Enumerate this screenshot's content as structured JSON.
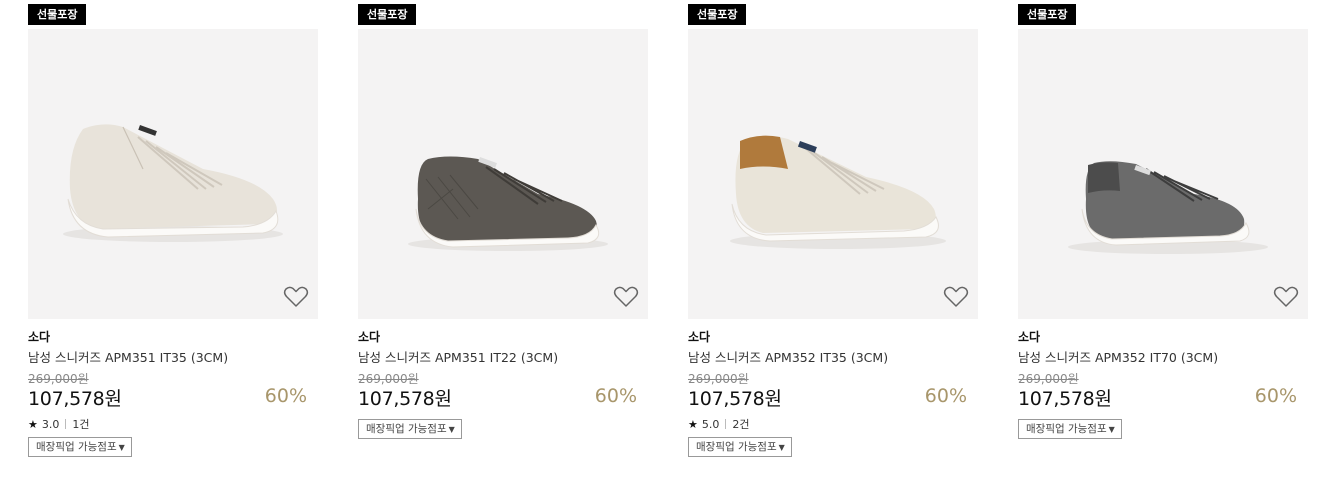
{
  "products": [
    {
      "badge": "선물포장",
      "brand": "소다",
      "name": "남성 스니커즈 APM351 IT35 (3CM)",
      "original_price": "269,000원",
      "price": "107,578원",
      "discount": "60%",
      "rating": "3.0",
      "review_count": "1건",
      "pickup_label": "매장픽업 가능점포",
      "shoe_color": "#e8e3da",
      "accent_color": "#d6cfc2"
    },
    {
      "badge": "선물포장",
      "brand": "소다",
      "name": "남성 스니커즈 APM351 IT22 (3CM)",
      "original_price": "269,000원",
      "price": "107,578원",
      "discount": "60%",
      "rating": "",
      "review_count": "",
      "pickup_label": "매장픽업 가능점포",
      "shoe_color": "#5c5853",
      "accent_color": "#4a4642"
    },
    {
      "badge": "선물포장",
      "brand": "소다",
      "name": "남성 스니커즈 APM352 IT35 (3CM)",
      "original_price": "269,000원",
      "price": "107,578원",
      "discount": "60%",
      "rating": "5.0",
      "review_count": "2건",
      "pickup_label": "매장픽업 가능점포",
      "shoe_color": "#e9e4d9",
      "accent_color": "#b07a3c"
    },
    {
      "badge": "선물포장",
      "brand": "소다",
      "name": "남성 스니커즈 APM352 IT70 (3CM)",
      "original_price": "269,000원",
      "price": "107,578원",
      "discount": "60%",
      "rating": "",
      "review_count": "",
      "pickup_label": "매장픽업 가능점포",
      "shoe_color": "#6b6b6b",
      "accent_color": "#4c4c4c"
    }
  ],
  "icons": {
    "wishlist": "heart-outline-icon",
    "rating": "star-icon",
    "dropdown": "caret-down-icon"
  },
  "colors": {
    "discount": "#a8966b",
    "badge_bg": "#000000",
    "thumb_bg": "#f4f3f3"
  }
}
